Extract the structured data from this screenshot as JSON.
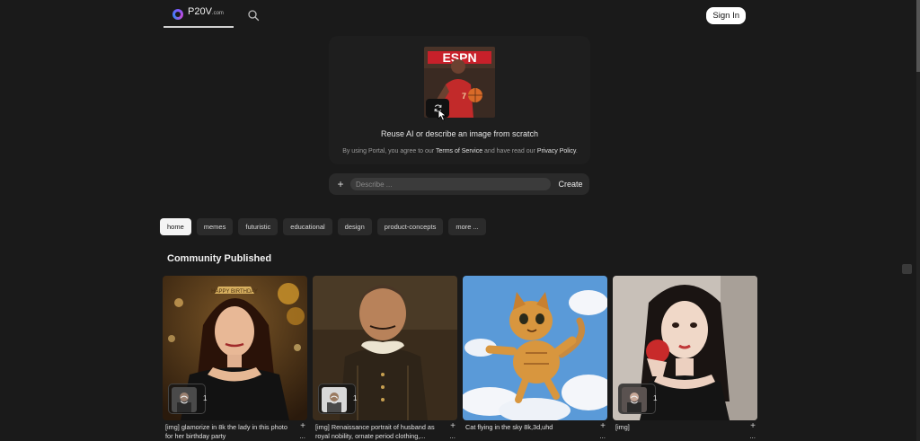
{
  "nav": {
    "logo_text": "P20V",
    "logo_suffix": ".com",
    "signin_label": "Sign In"
  },
  "hero": {
    "title": "Reuse AI or describe an image from scratch",
    "terms_prefix": "By using Portal, you agree to our ",
    "terms_link": "Terms of Service",
    "terms_middle": " and have read our ",
    "privacy_link": "Privacy Policy",
    "terms_suffix": ".",
    "plus_label": "+",
    "describe_placeholder": "Describe ...",
    "create_label": "Create"
  },
  "tags": [
    "home",
    "memes",
    "futuristic",
    "educational",
    "design",
    "product-concepts",
    "more ..."
  ],
  "section_title": "Community Published",
  "cards": [
    {
      "caption": "[img] glamorize in 8k the lady in this photo for her birthday party",
      "count": "1"
    },
    {
      "caption": "[img] Renaissance portrait of husband as royal nobility, ornate period clothing,...",
      "count": "1"
    },
    {
      "caption": "Cat flying in the sky 8k,3d,uhd",
      "count": ""
    },
    {
      "caption": "[img]",
      "count": "1"
    }
  ],
  "card_actions": {
    "add": "+",
    "more": "..."
  },
  "colors": {
    "background": "#1a1a1a",
    "tag_active": "#f4f4f4",
    "card_surface": "#1e1e1e"
  },
  "icons": [
    "search-icon",
    "reuse-icon",
    "plus-icon",
    "cursor-icon"
  ]
}
